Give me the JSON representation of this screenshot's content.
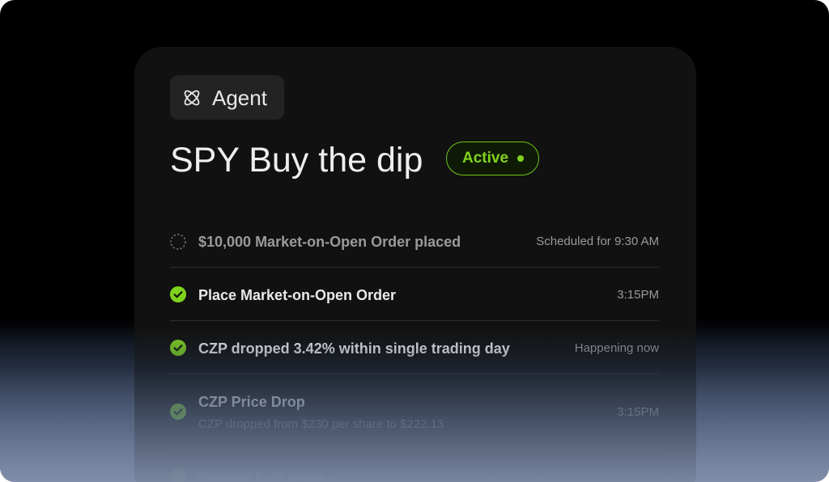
{
  "agent": {
    "label": "Agent",
    "icon": "atom-icon"
  },
  "task": {
    "title": "SPY Buy the dip",
    "status": "Active"
  },
  "colors": {
    "accent_green": "#7fd31e",
    "card_bg": "#111111",
    "chip_bg": "#232323"
  },
  "timeline": [
    {
      "state": "pending",
      "icon": "dashed-circle-icon",
      "label": "$10,000 Market-on-Open Order placed",
      "time": "Scheduled for 9:30 AM"
    },
    {
      "state": "done",
      "icon": "check-circle-icon",
      "label": "Place Market-on-Open Order",
      "time": "3:15PM"
    },
    {
      "state": "done",
      "icon": "check-circle-icon",
      "label": "CZP dropped 3.42% within single trading day",
      "time": "Happening now"
    },
    {
      "state": "done",
      "icon": "check-circle-icon",
      "label": "CZP Price Drop",
      "sublabel": "CZP dropped from $230 per share to $222.13",
      "time": "3:15PM"
    },
    {
      "state": "done",
      "icon": "check-circle-icon",
      "label": "Monitor CZP price",
      "time": ""
    }
  ]
}
